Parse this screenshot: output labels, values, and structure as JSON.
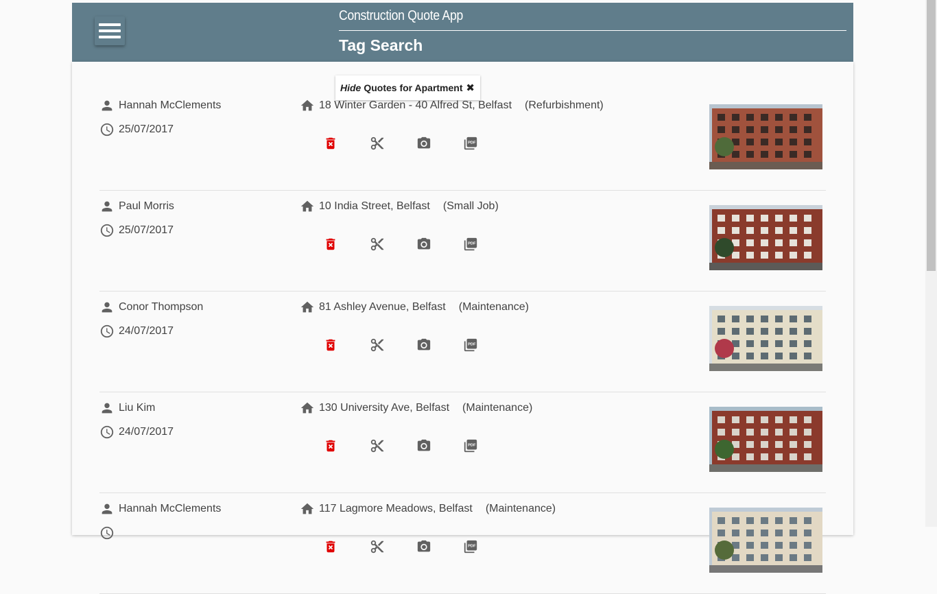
{
  "header": {
    "app_title": "Construction Quote App",
    "page_title": "Tag Search",
    "color": "#607d8b"
  },
  "filter": {
    "hide_label": "Hide",
    "rest_label": "Quotes for Apartment",
    "close_glyph": "✖"
  },
  "icons": {
    "person": "person-icon",
    "clock": "clock-icon",
    "home": "home-icon",
    "delete": "delete-icon",
    "cut": "scissors-icon",
    "camera": "camera-icon",
    "pdf": "pdf-icon",
    "delete_color": "#e00000",
    "icon_color": "#616161"
  },
  "quotes": [
    {
      "name": "Hannah McClements",
      "date": "25/07/2017",
      "address": "18 Winter Garden - 40 Alfred St, Belfast",
      "type": "(Refurbishment)"
    },
    {
      "name": "Paul Morris",
      "date": "25/07/2017",
      "address": "10 India Street, Belfast",
      "type": "(Small Job)"
    },
    {
      "name": "Conor Thompson",
      "date": "24/07/2017",
      "address": "81 Ashley Avenue, Belfast",
      "type": "(Maintenance)"
    },
    {
      "name": "Liu Kim",
      "date": "24/07/2017",
      "address": "130 University Ave, Belfast",
      "type": "(Maintenance)"
    },
    {
      "name": "Hannah McClements",
      "date": "",
      "address": "117 Lagmore Meadows, Belfast",
      "type": "(Maintenance)"
    }
  ]
}
